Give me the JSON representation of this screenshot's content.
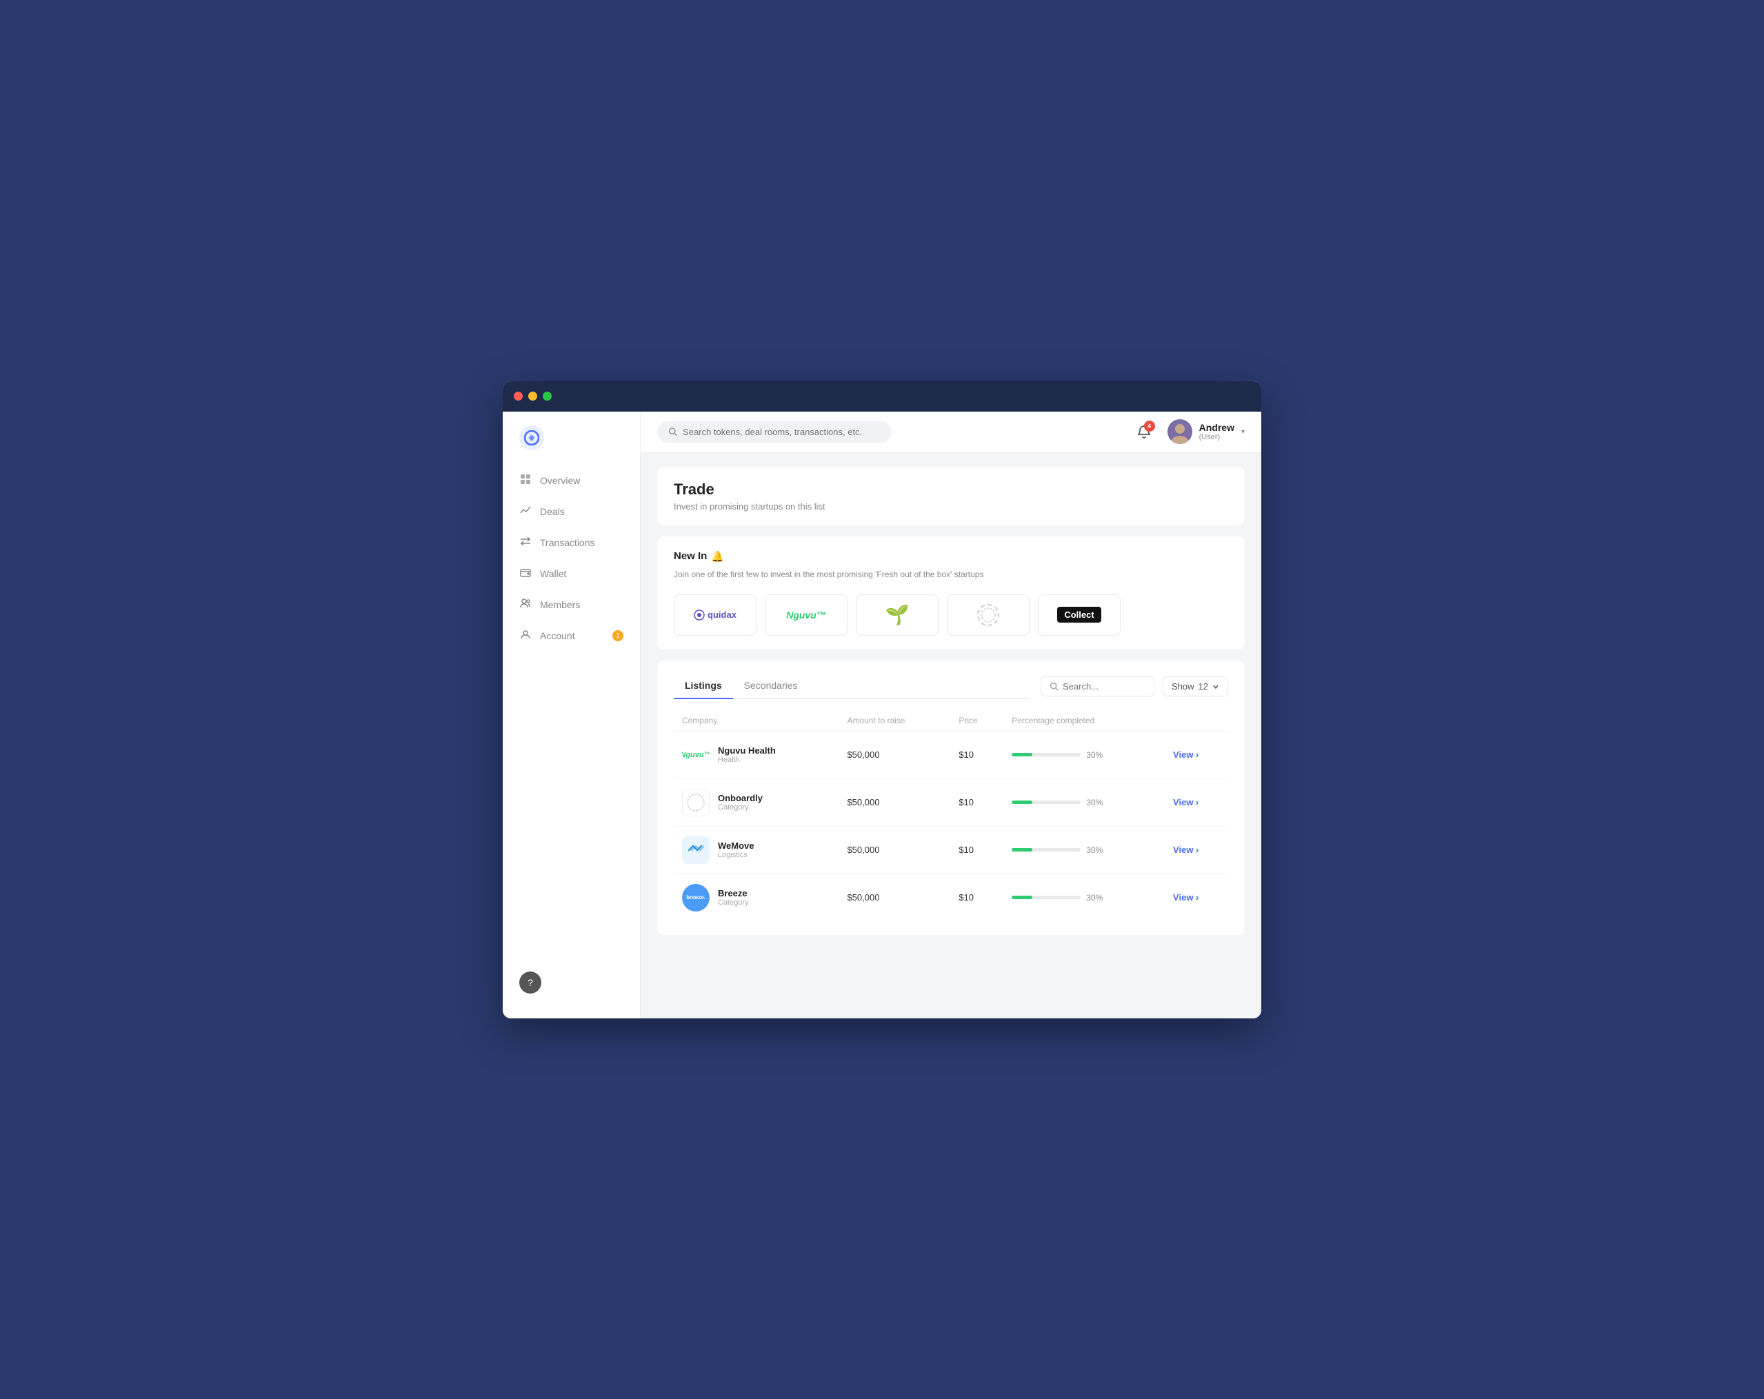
{
  "window": {
    "titlebar_dots": [
      "red",
      "yellow",
      "green"
    ]
  },
  "topbar": {
    "search_placeholder": "Search tokens, deal rooms, transactions, etc.",
    "notifications_count": "4",
    "user_name": "Andrew",
    "user_role": "(User)"
  },
  "sidebar": {
    "nav_items": [
      {
        "id": "overview",
        "label": "Overview",
        "icon": "▦",
        "badge": null
      },
      {
        "id": "deals",
        "label": "Deals",
        "icon": "↗",
        "badge": null
      },
      {
        "id": "transactions",
        "label": "Transactions",
        "icon": "⇄",
        "badge": null
      },
      {
        "id": "wallet",
        "label": "Wallet",
        "icon": "▣",
        "badge": null
      },
      {
        "id": "members",
        "label": "Members",
        "icon": "👥",
        "badge": null
      },
      {
        "id": "account",
        "label": "Account",
        "icon": "👤",
        "badge": "1"
      }
    ],
    "help_label": "?"
  },
  "page": {
    "title": "Trade",
    "subtitle": "Invest in promising startups on this list"
  },
  "new_in": {
    "title": "New In",
    "subtitle": "Join one of the first few to invest in the most promising 'Fresh\nout of the box' startups",
    "companies": [
      {
        "id": "quidax",
        "label": "quidax",
        "style": "text"
      },
      {
        "id": "nguvu",
        "label": "Nguvu™",
        "style": "nguvu"
      },
      {
        "id": "plant",
        "label": "🌱",
        "style": "emoji"
      },
      {
        "id": "onboardly",
        "label": "",
        "style": "circle"
      },
      {
        "id": "collect",
        "label": "Collect",
        "style": "black"
      }
    ]
  },
  "listings": {
    "tabs": [
      {
        "id": "listings",
        "label": "Listings",
        "active": true
      },
      {
        "id": "secondaries",
        "label": "Secondaries",
        "active": false
      }
    ],
    "search_placeholder": "Search...",
    "show_label": "Show",
    "show_value": "12",
    "columns": [
      "Company",
      "Amount to raise",
      "Price",
      "Percentage completed"
    ],
    "rows": [
      {
        "id": "nguvu-health",
        "company_name": "Nguvu Health",
        "category": "Health",
        "amount": "$50,000",
        "price": "$10",
        "percentage": 30,
        "percentage_label": "30%",
        "logo_type": "nguvu"
      },
      {
        "id": "onboardly",
        "company_name": "Onboardly",
        "category": "Category",
        "amount": "$50,000",
        "price": "$10",
        "percentage": 30,
        "percentage_label": "30%",
        "logo_type": "onboardly"
      },
      {
        "id": "wemove",
        "company_name": "WeMove",
        "category": "Logistics",
        "amount": "$50,000",
        "price": "$10",
        "percentage": 30,
        "percentage_label": "30%",
        "logo_type": "wemove"
      },
      {
        "id": "breeze",
        "company_name": "Breeze",
        "category": "Category",
        "amount": "$50,000",
        "price": "$10",
        "percentage": 30,
        "percentage_label": "30%",
        "logo_type": "breeze"
      }
    ],
    "view_label": "View ›"
  }
}
